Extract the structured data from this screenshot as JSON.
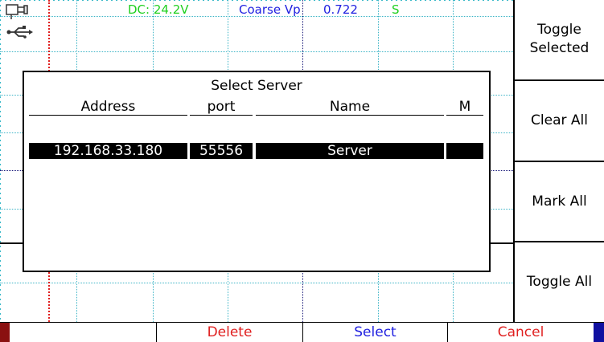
{
  "status": {
    "dc_reading": "DC: 24.2V",
    "mode_label": "Coarse Vp",
    "mode_value": "0.722",
    "indicator": "S"
  },
  "colors": {
    "dc": "#1fd01f",
    "mode": "#2020e0",
    "indicator": "#1fd01f",
    "delete": "#e02020",
    "select": "#2020e0",
    "cancel": "#e02020"
  },
  "icons": [
    "usb-icon"
  ],
  "softkeys": {
    "toggle_selected": "Toggle\nSelected",
    "clear_all": "Clear All",
    "mark_all": "Mark All",
    "toggle_all": "Toggle All"
  },
  "bottombar": {
    "key1": "",
    "delete": "Delete",
    "select": "Select",
    "cancel": "Cancel"
  },
  "dialog": {
    "title": "Select Server",
    "columns": {
      "address": "Address",
      "port": "port",
      "name": "Name",
      "mark": "M"
    },
    "rows": [
      {
        "address": "192.168.33.180",
        "port": "55556",
        "name": "Server",
        "mark": ""
      }
    ]
  }
}
